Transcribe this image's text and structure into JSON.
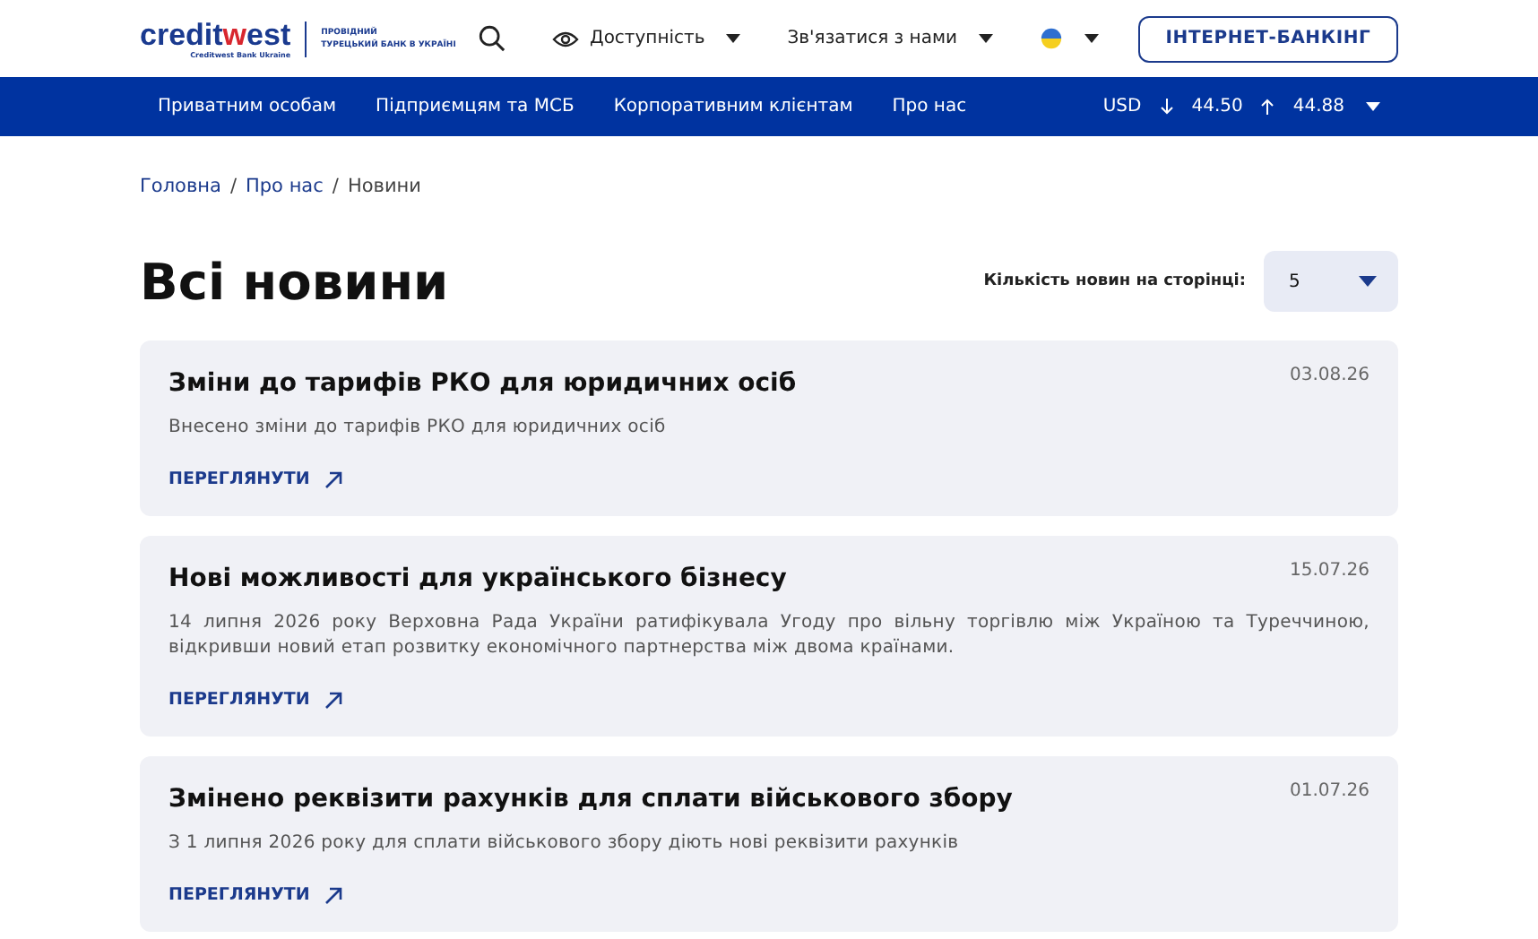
{
  "header": {
    "logo": {
      "brand_start": "credit",
      "brand_accent": "w",
      "brand_end": "est",
      "subtitle": "Creditwest Bank Ukraine",
      "tagline_1": "ПРОВІДНИЙ",
      "tagline_2": "ТУРЕЦЬКИЙ БАНК В УКРАЇНІ"
    },
    "accessibility": "Доступність",
    "contact": "Зв'язатися з нами",
    "banking_button": "ІНТЕРНЕТ-БАНКІНГ"
  },
  "nav": {
    "items": [
      "Приватним особам",
      "Підприємцям та МСБ",
      "Корпоративним клієнтам",
      "Про нас"
    ],
    "currency": {
      "code": "USD",
      "buy": "44.50",
      "sell": "44.88"
    }
  },
  "breadcrumbs": [
    {
      "label": "Головна",
      "link": true
    },
    {
      "separator": "/",
      "label": "Про нас",
      "link": true
    },
    {
      "separator": "/",
      "label": "Новини",
      "link": false
    }
  ],
  "page_title": "Всі новини",
  "per_page": {
    "label": "Кількість новин на сторінці:",
    "value": "5"
  },
  "news": [
    {
      "title": "Зміни до тарифів РКО для юридичних осіб",
      "date": "03.08.26",
      "summary": "Внесено зміни до тарифів РКО для юридичних осіб",
      "link": "ПЕРЕГЛЯНУТИ"
    },
    {
      "title": "Нові можливості для українського бізнесу",
      "date": "15.07.26",
      "summary": "14 липня 2026 року Верховна Рада України ратифікувала Угоду про вільну торгівлю між Україною та Туреччиною, відкривши новий етап розвитку економічного партнерства між двома країнами.",
      "link": "ПЕРЕГЛЯНУТИ"
    },
    {
      "title": "Змінено реквізити рахунків для сплати військового збору",
      "date": "01.07.26",
      "summary": "З 1 липня 2026 року для сплати військового збору діють нові реквізити рахунків",
      "link": "ПЕРЕГЛЯНУТИ"
    }
  ]
}
